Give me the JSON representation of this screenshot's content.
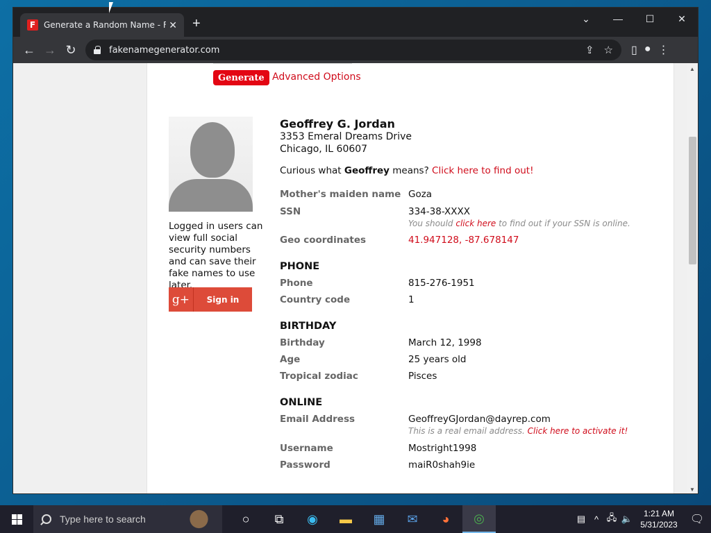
{
  "browser": {
    "tab_title": "Generate a Random Name - Fake",
    "favicon_letter": "F",
    "url": "fakenamegenerator.com",
    "new_tab": "+",
    "close_tab": "✕"
  },
  "page": {
    "generate_label": "Generate",
    "advanced_label": "Advanced Options",
    "login_note": "Logged in users can view full social security numbers and can save their fake names to use later.",
    "signin_label": "Sign in",
    "gplus_glyph": "g+",
    "person": {
      "name": "Geoffrey G. Jordan",
      "address_line1": "3353 Emeral Dreams Drive",
      "address_line2": "Chicago, IL 60607",
      "curious_prefix": "Curious what ",
      "curious_name": "Geoffrey",
      "curious_mid": " means? ",
      "curious_link": "Click here to find out!"
    },
    "fields": {
      "maiden_label": "Mother's maiden name",
      "maiden_value": "Goza",
      "ssn_label": "SSN",
      "ssn_value": "334-38-XXXX",
      "ssn_note_prefix": "You should ",
      "ssn_note_link": "click here",
      "ssn_note_suffix": " to find out if your SSN is online.",
      "geo_label": "Geo coordinates",
      "geo_value": "41.947128, -87.678147"
    },
    "phone": {
      "section": "PHONE",
      "phone_label": "Phone",
      "phone_value": "815-276-1951",
      "cc_label": "Country code",
      "cc_value": "1"
    },
    "birthday": {
      "section": "BIRTHDAY",
      "birthday_label": "Birthday",
      "birthday_value": "March 12, 1998",
      "age_label": "Age",
      "age_value": "25 years old",
      "zodiac_label": "Tropical zodiac",
      "zodiac_value": "Pisces"
    },
    "online": {
      "section": "ONLINE",
      "email_label": "Email Address",
      "email_value": "GeoffreyGJordan@dayrep.com",
      "email_note_prefix": "This is a real email address. ",
      "email_note_link": "Click here to activate it!",
      "username_label": "Username",
      "username_value": "Mostright1998",
      "password_label": "Password",
      "password_value": "maiR0shah9ie"
    }
  },
  "taskbar": {
    "search_placeholder": "Type here to search",
    "time": "1:21 AM",
    "date": "5/31/2023"
  }
}
